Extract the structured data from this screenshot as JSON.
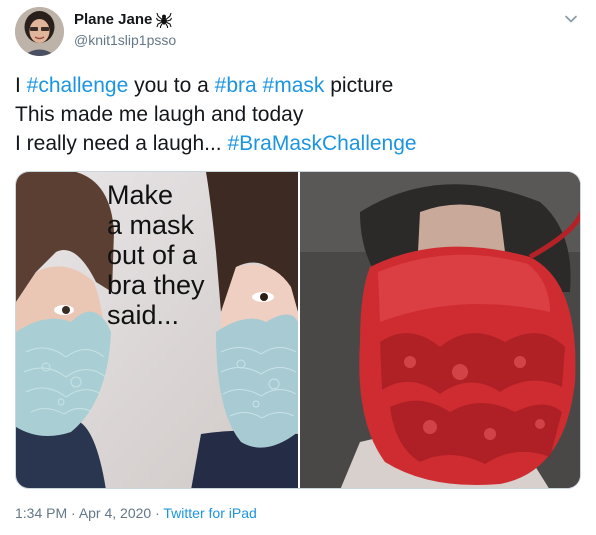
{
  "author": {
    "name": "Plane Jane",
    "handle": "@knit1slip1psso",
    "avatar_icon": "avatar-photo",
    "name_emoji_icon": "spider-icon"
  },
  "tweet": {
    "lines": [
      [
        {
          "t": "I ",
          "tag": false
        },
        {
          "t": "#challenge",
          "tag": true
        },
        {
          "t": " you to a ",
          "tag": false
        },
        {
          "t": "#bra",
          "tag": true
        },
        {
          "t": " ",
          "tag": false
        },
        {
          "t": "#mask",
          "tag": true
        },
        {
          "t": " picture",
          "tag": false
        }
      ],
      [
        {
          "t": "This made me laugh and today",
          "tag": false
        }
      ],
      [
        {
          "t": "I really need a laugh... ",
          "tag": false
        },
        {
          "t": "#BraMaskChallenge",
          "tag": true
        }
      ]
    ]
  },
  "media": {
    "meme_text": "Make\na mask\nout of a\nbra they\nsaid..."
  },
  "footer": {
    "time": "1:34 PM",
    "sep1": " · ",
    "date": "Apr 4, 2020",
    "sep2": " · ",
    "source": "Twitter for iPad"
  },
  "colors": {
    "link": "#1b95e0",
    "text": "#14171a",
    "muted": "#657786"
  },
  "menu_icon": "chevron-down-icon"
}
